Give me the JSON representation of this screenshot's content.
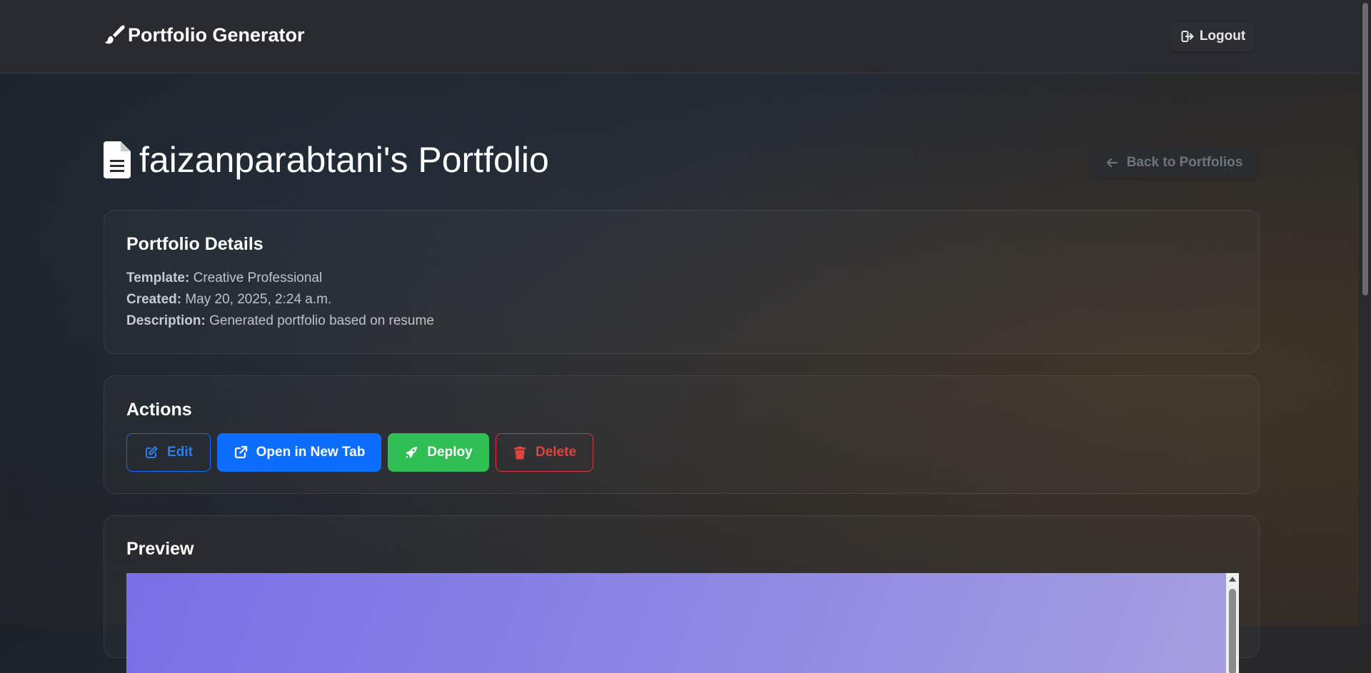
{
  "navbar": {
    "brand": "Portfolio Generator",
    "brand_icon": "paint-brush-icon",
    "logout_label": "Logout",
    "logout_icon": "sign-out-icon"
  },
  "header": {
    "title": "faizanparabtani's Portfolio",
    "title_icon": "file-document-icon",
    "back_label": "Back to Portfolios",
    "back_icon": "arrow-left-icon"
  },
  "details": {
    "title": "Portfolio Details",
    "template_label": "Template:",
    "template_value": "Creative Professional",
    "created_label": "Created:",
    "created_value": "May 20, 2025, 2:24 a.m.",
    "description_label": "Description:",
    "description_value": "Generated portfolio based on resume"
  },
  "actions": {
    "title": "Actions",
    "edit_label": "Edit",
    "open_label": "Open in New Tab",
    "deploy_label": "Deploy",
    "delete_label": "Delete"
  },
  "preview": {
    "title": "Preview"
  },
  "colors": {
    "primary": "#0d6efd",
    "success": "#2fbf55",
    "danger": "#dc3545",
    "muted": "#6c757d",
    "preview_gradient_start": "#7a6fe6",
    "preview_gradient_end": "#a69fe0"
  }
}
